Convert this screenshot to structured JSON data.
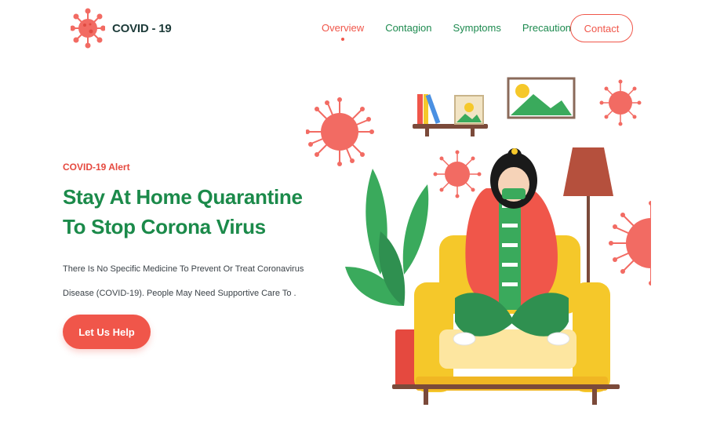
{
  "header": {
    "logo_text": "COVID - 19",
    "nav": [
      {
        "label": "Overview",
        "active": true
      },
      {
        "label": "Contagion",
        "active": false
      },
      {
        "label": "Symptoms",
        "active": false
      },
      {
        "label": "Precautions",
        "active": false
      }
    ],
    "contact_label": "Contact"
  },
  "hero": {
    "alert": "COVID-19 Alert",
    "title_line1": "Stay At Home Quarantine",
    "title_line2": "To Stop Corona Virus",
    "description_line1": "There Is No Specific Medicine To Prevent Or Treat Coronavirus",
    "description_line2": "Disease (COVID-19). People May Need Supportive Care To .",
    "cta_label": "Let Us Help"
  },
  "colors": {
    "accent_red": "#f0564a",
    "brand_green": "#1b8a4a",
    "dark_text": "#1d3b39",
    "virus_pink": "#f26b63",
    "sofa_yellow": "#f5c82a"
  },
  "illustration": {
    "icon": "woman-on-sofa-quarantine-illustration"
  }
}
